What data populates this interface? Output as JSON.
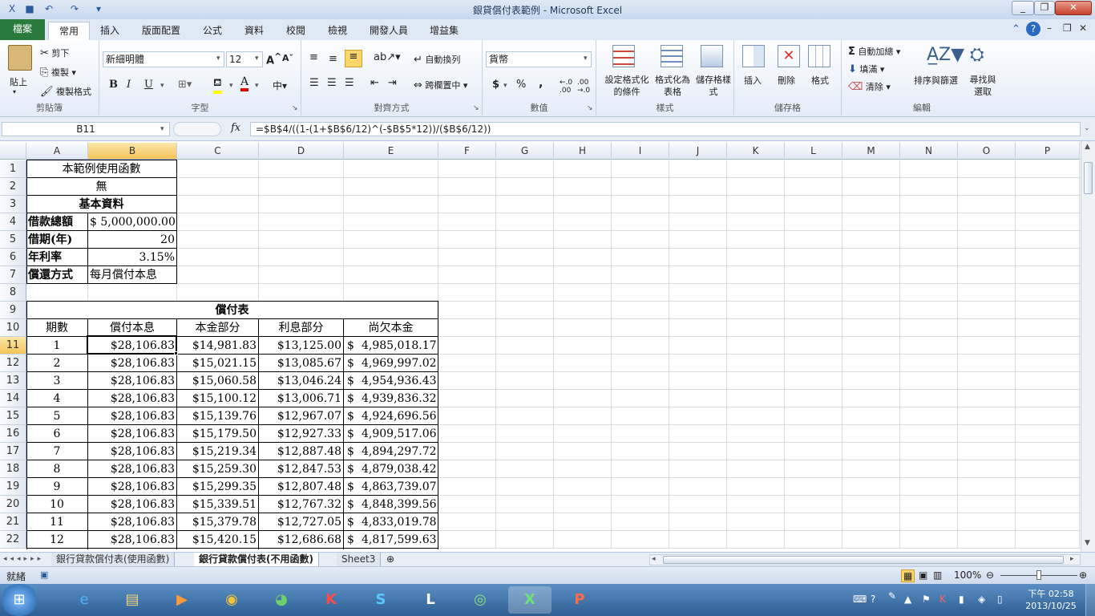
{
  "window": {
    "title": "銀貸償付表範例 - Microsoft Excel"
  },
  "ribbon_tabs": [
    "檔案",
    "常用",
    "插入",
    "版面配置",
    "公式",
    "資料",
    "校閱",
    "檢視",
    "開發人員",
    "增益集"
  ],
  "clipboard": {
    "paste": "貼上",
    "cut": "剪下",
    "copy": "複製",
    "format_painter": "複製格式",
    "label": "剪貼簿"
  },
  "font": {
    "name": "新細明體",
    "size": "12",
    "bold": "B",
    "italic": "I",
    "underline": "U",
    "label": "字型"
  },
  "alignment": {
    "wrap": "自動換列",
    "merge": "跨欄置中",
    "label": "對齊方式"
  },
  "number": {
    "format": "貨幣",
    "currency": "$",
    "percent": "%",
    "comma": ",",
    "label": "數值"
  },
  "styles": {
    "conditional": "設定格式化的條件",
    "format_table": "格式化為表格",
    "cell_styles": "儲存格樣式",
    "label": "樣式"
  },
  "cells": {
    "insert": "插入",
    "delete": "刪除",
    "format": "格式",
    "label": "儲存格"
  },
  "editing": {
    "autosum": "自動加總",
    "fill": "填滿",
    "clear": "清除",
    "sort": "排序與篩選",
    "find": "尋找與選取",
    "label": "編輯"
  },
  "formula_bar": {
    "name_box": "B11",
    "fx": "fx",
    "formula": "=$B$4/((1-(1+$B$6/12)^(-$B$5*12))/($B$6/12))"
  },
  "columns": [
    "A",
    "B",
    "C",
    "D",
    "E",
    "F",
    "G",
    "H",
    "I",
    "J",
    "K",
    "L",
    "M",
    "N",
    "O",
    "P"
  ],
  "rows": [
    "1",
    "2",
    "3",
    "4",
    "5",
    "6",
    "7",
    "8",
    "9",
    "10",
    "11",
    "12",
    "13",
    "14",
    "15",
    "16",
    "17",
    "18",
    "19",
    "20",
    "21",
    "22"
  ],
  "sheet": {
    "a1": "本範例使用函數",
    "a2": "無",
    "a3": "基本資料",
    "a4": "借款總額",
    "b4": "$ 5,000,000.00",
    "a5": "借期(年)",
    "b5": "20",
    "a6": "年利率",
    "b6": "3.15%",
    "a7": "償還方式",
    "b7": "每月償付本息",
    "a9": "償付表",
    "headers": [
      "期數",
      "償付本息",
      "本金部分",
      "利息部分",
      "尚欠本金"
    ],
    "table": [
      [
        "1",
        "$28,106.83",
        "$14,981.83",
        "$13,125.00",
        "$",
        "4,985,018.17"
      ],
      [
        "2",
        "$28,106.83",
        "$15,021.15",
        "$13,085.67",
        "$",
        "4,969,997.02"
      ],
      [
        "3",
        "$28,106.83",
        "$15,060.58",
        "$13,046.24",
        "$",
        "4,954,936.43"
      ],
      [
        "4",
        "$28,106.83",
        "$15,100.12",
        "$13,006.71",
        "$",
        "4,939,836.32"
      ],
      [
        "5",
        "$28,106.83",
        "$15,139.76",
        "$12,967.07",
        "$",
        "4,924,696.56"
      ],
      [
        "6",
        "$28,106.83",
        "$15,179.50",
        "$12,927.33",
        "$",
        "4,909,517.06"
      ],
      [
        "7",
        "$28,106.83",
        "$15,219.34",
        "$12,887.48",
        "$",
        "4,894,297.72"
      ],
      [
        "8",
        "$28,106.83",
        "$15,259.30",
        "$12,847.53",
        "$",
        "4,879,038.42"
      ],
      [
        "9",
        "$28,106.83",
        "$15,299.35",
        "$12,807.48",
        "$",
        "4,863,739.07"
      ],
      [
        "10",
        "$28,106.83",
        "$15,339.51",
        "$12,767.32",
        "$",
        "4,848,399.56"
      ],
      [
        "11",
        "$28,106.83",
        "$15,379.78",
        "$12,727.05",
        "$",
        "4,833,019.78"
      ],
      [
        "12",
        "$28,106.83",
        "$15,420.15",
        "$12,686.68",
        "$",
        "4,817,599.63"
      ]
    ]
  },
  "sheet_tabs": [
    "銀行貸款償付表(使用函數)",
    "銀行貸款償付表(不用函數)",
    "Sheet3"
  ],
  "status": {
    "ready": "就緒",
    "zoom": "100%"
  },
  "clock": {
    "time": "下午 02:58",
    "date": "2013/10/25"
  },
  "colors": {
    "file_tab": "#2b7a3d",
    "selected_header": "#f5c35b",
    "taskbar": "#2d5e93"
  },
  "taskbar_icons": [
    "ie-icon",
    "explorer-icon",
    "media-player-icon",
    "chrome-icon",
    "picasa-icon",
    "kaspersky-icon",
    "skype-icon",
    "lync-icon",
    "dreamweaver-icon",
    "excel-icon",
    "powerpoint-icon"
  ]
}
